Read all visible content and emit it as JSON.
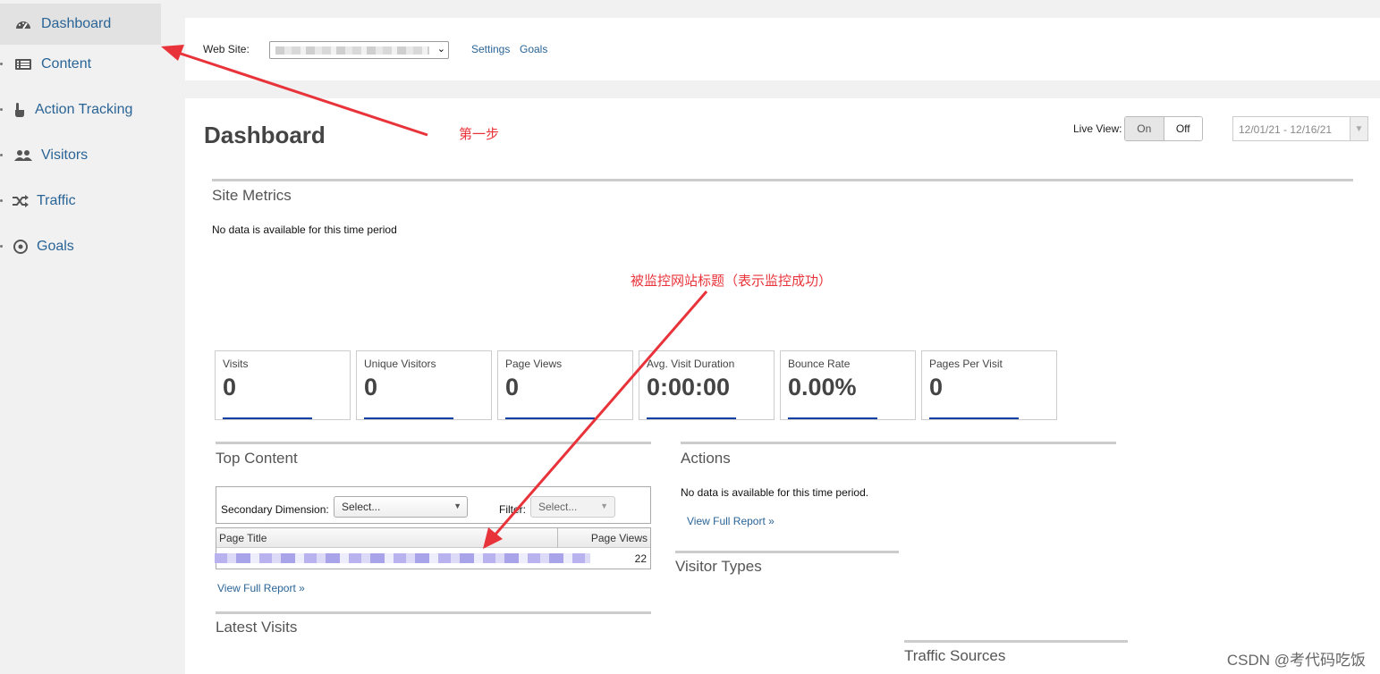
{
  "sidebar": {
    "items": [
      {
        "label": "Dashboard",
        "icon": "gauge-icon"
      },
      {
        "label": "Content",
        "icon": "list-icon"
      },
      {
        "label": "Action Tracking",
        "icon": "hand-pointer-icon"
      },
      {
        "label": "Visitors",
        "icon": "users-icon"
      },
      {
        "label": "Traffic",
        "icon": "shuffle-icon"
      },
      {
        "label": "Goals",
        "icon": "target-icon"
      }
    ]
  },
  "toolbar": {
    "website_label": "Web Site:",
    "settings_link": "Settings",
    "goals_link": "Goals"
  },
  "main": {
    "title": "Dashboard",
    "live_view_label": "Live View:",
    "live_on": "On",
    "live_off": "Off",
    "date_range": "12/01/21 - 12/16/21",
    "site_metrics": {
      "title": "Site Metrics",
      "no_data": "No data is available for this time period"
    },
    "metrics": [
      {
        "label": "Visits",
        "value": "0"
      },
      {
        "label": "Unique Visitors",
        "value": "0"
      },
      {
        "label": "Page Views",
        "value": "0"
      },
      {
        "label": "Avg. Visit Duration",
        "value": "0:00:00"
      },
      {
        "label": "Bounce Rate",
        "value": "0.00%"
      },
      {
        "label": "Pages Per Visit",
        "value": "0"
      }
    ],
    "top_content": {
      "title": "Top Content",
      "secondary_dimension_label": "Secondary Dimension:",
      "secondary_dimension_value": "Select...",
      "filter_label": "Filter:",
      "filter_value": "Select...",
      "columns": [
        "Page Title",
        "Page Views"
      ],
      "rows": [
        {
          "page_views": "22"
        }
      ],
      "view_full_report": "View Full Report »"
    },
    "actions": {
      "title": "Actions",
      "no_data": "No data is available for this time period.",
      "view_full_report": "View Full Report »"
    },
    "visitor_types_title": "Visitor Types",
    "latest_visits_title": "Latest Visits",
    "traffic_sources_title": "Traffic Sources"
  },
  "annotations": {
    "step1": "第一步",
    "monitored_title": "被监控网站标题（表示监控成功）",
    "color": "#e8333a"
  },
  "watermark": "CSDN @考代码吃饭",
  "colors": {
    "link": "#2a6496",
    "metric_underline": "#0b3fa6"
  }
}
